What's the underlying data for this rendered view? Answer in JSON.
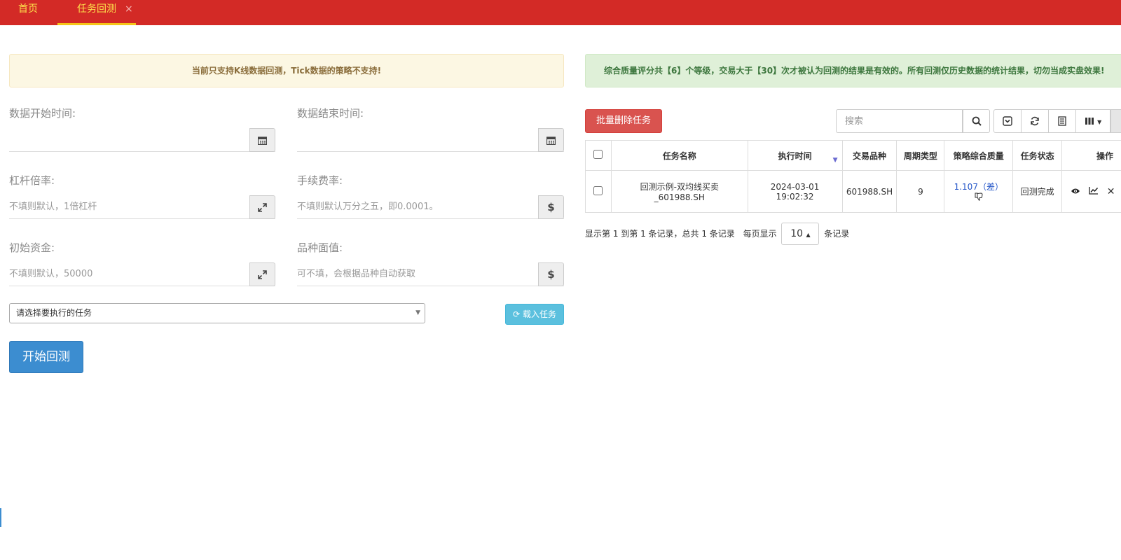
{
  "tabs": {
    "home": "首页",
    "active": "任务回测",
    "close": "×"
  },
  "left": {
    "notice": "当前只支持K线数据回测，Tick数据的策略不支持!",
    "start_time": {
      "label": "数据开始时间:",
      "value": "",
      "icon": "calendar-icon"
    },
    "end_time": {
      "label": "数据结束时间:",
      "value": "",
      "icon": "calendar-icon"
    },
    "leverage": {
      "label": "杠杆倍率:",
      "placeholder": "不填则默认，1倍杠杆",
      "icon": "expand-icon"
    },
    "fee_rate": {
      "label": "手续费率:",
      "placeholder": "不填则默认万分之五，即0.0001。",
      "icon": "dollar-icon"
    },
    "capital": {
      "label": "初始资金:",
      "placeholder": "不填则默认，50000",
      "icon": "expand-icon"
    },
    "face_value": {
      "label": "品种面值:",
      "placeholder": "可不填，会根据品种自动获取",
      "icon": "dollar-icon"
    },
    "task_select": "请选择要执行的任务",
    "load_button": "载入任务",
    "start_button": "开始回测"
  },
  "right": {
    "notice": "综合质量评分共【6】个等级，交易大于【30】次才被认为回测的结果是有效的。所有回测仅历史数据的统计结果，切勿当成实盘效果!",
    "batch_delete": "批量删除任务",
    "search_placeholder": "搜索",
    "columns": [
      "任务名称",
      "执行时间",
      "交易品种",
      "周期类型",
      "策略综合质量",
      "任务状态",
      "操作"
    ],
    "rows": [
      {
        "name_line1": "回测示例-双均线买卖",
        "name_line2": "_601988.SH",
        "time_line1": "2024-03-01",
        "time_line2": "19:02:32",
        "symbol": "601988.SH",
        "period": "9",
        "quality": "1.107（差）",
        "status": "回测完成"
      }
    ],
    "pager": {
      "summary": "显示第 1 到第 1 条记录，总共 1 条记录",
      "per_page_label": "每页显示",
      "page_size": "10",
      "suffix": "条记录"
    }
  },
  "colors": {
    "topbar": "#d32a26",
    "tab_text": "#fde04b",
    "danger": "#d9534f",
    "info": "#5bc0de",
    "primary": "#3c8dd0",
    "success_text": "#3a9d23",
    "link": "#2456c8"
  }
}
